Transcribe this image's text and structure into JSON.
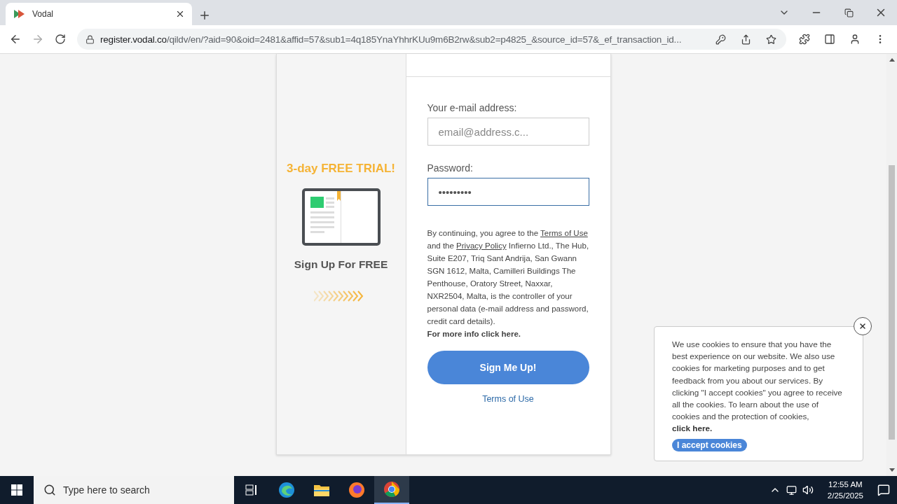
{
  "browser": {
    "tab": {
      "title": "Vodal",
      "selected": true
    },
    "url_host": "register.vodal.co",
    "url_path": "/qildv/en/?aid=90&oid=2481&affid=57&sub1=4q185YnaYhhrKUu9m6B2rw&sub2=p4825_&source_id=57&_ef_transaction_id..."
  },
  "promo": {
    "title": "3-day FREE TRIAL!",
    "subtitle": "Sign Up For FREE"
  },
  "form": {
    "fields": [
      {
        "label": "Your e-mail address:",
        "placeholder": "email@address.c...",
        "focused": false
      },
      {
        "label": "Password:",
        "value": "•••••••••",
        "focused": true
      }
    ],
    "legal": [
      {
        "kind": "plain",
        "text": "By continuing, you agree to the "
      },
      {
        "kind": "link",
        "text": "Terms of Use"
      },
      {
        "kind": "plain",
        "text": " and the "
      },
      {
        "kind": "link",
        "text": "Privacy Policy"
      },
      {
        "kind": "plain",
        "text": " Infierno Ltd., The Hub, Suite E207, Triq Sant Andrija, San Gwann SGN 1612, Malta, Camilleri Buildings The Penthouse, Oratory Street, Naxxar, NXR2504, Malta, is the controller of your personal data (e-mail address and password, credit card details)."
      }
    ],
    "more_info": "For more info click here.",
    "submit": "Sign Me Up!",
    "terms_link": "Terms of Use"
  },
  "cookie_banner": {
    "text": "We use cookies to ensure that you have the best experience on our website. We also use cookies for marketing purposes and to get feedback from you about our services. By clicking \"I accept cookies\" you agree to receive all the cookies. To learn about the use of cookies and the protection of cookies, ",
    "link": "click here.",
    "accept": "I accept cookies"
  },
  "taskbar": {
    "search_placeholder": "Type here to search",
    "apps": [
      {
        "kind": "taskview",
        "selected": false
      },
      {
        "kind": "edge",
        "selected": false
      },
      {
        "kind": "explorer",
        "selected": false
      },
      {
        "kind": "firefox",
        "selected": false
      },
      {
        "kind": "chrome",
        "selected": true
      }
    ],
    "time": "12:55 AM",
    "date": "2/25/2025"
  }
}
